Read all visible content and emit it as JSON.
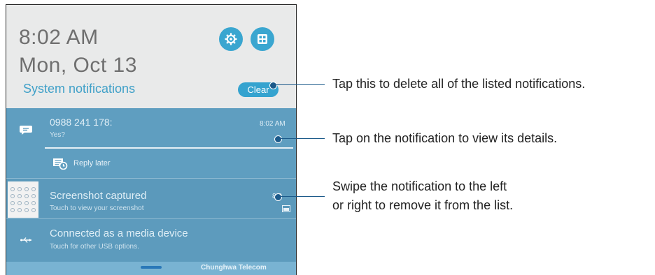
{
  "header": {
    "time": "8:02 AM",
    "date": "Mon, Oct 13",
    "section_title": "System notifications",
    "clear_label": "Clear"
  },
  "notifications": [
    {
      "title": "0988 241 178:",
      "subtitle": "Yes?",
      "time": "8:02 AM",
      "action_label": "Reply later",
      "icon": "message-icon"
    },
    {
      "title": "Screenshot captured",
      "subtitle": "Touch to view your screenshot",
      "time": "8:0",
      "icon": "screenshot-thumbnail"
    },
    {
      "title": "Connected as a media device",
      "subtitle": "Touch for other USB options.",
      "icon": "usb-icon"
    }
  ],
  "status": {
    "carrier": "Chunghwa Telecom"
  },
  "callouts": {
    "clear": "Tap this to delete all of the listed notifications.",
    "details": "Tap on the notification to view its details.",
    "swipe_line1": "Swipe the notification to the left",
    "swipe_line2": "or right to remove it from the list."
  },
  "colors": {
    "accent": "#3aa6d0",
    "panel": "#5d9bbd",
    "callout": "#1c5a8a"
  }
}
